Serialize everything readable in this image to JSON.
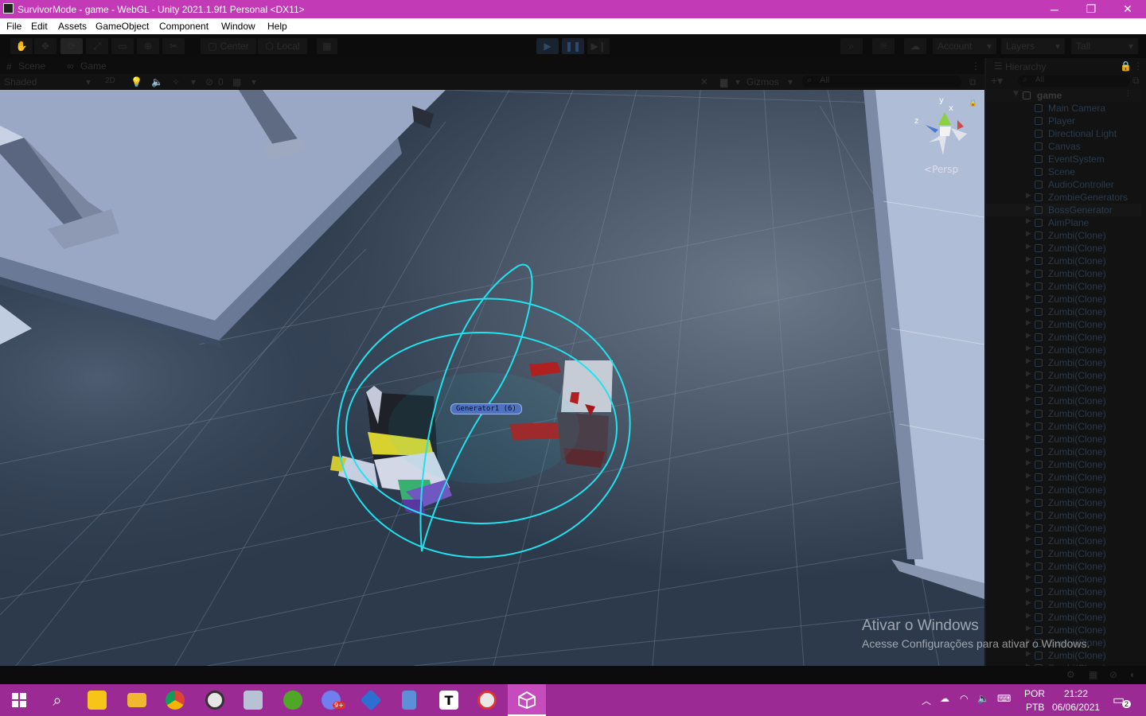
{
  "window": {
    "title": "SurvivorMode - game - WebGL - Unity 2021.1.9f1 Personal <DX11>",
    "minimize": "─",
    "maximize": "❐",
    "close": "✕"
  },
  "menu": [
    "File",
    "Edit",
    "Assets",
    "GameObject",
    "Component",
    "Window",
    "Help"
  ],
  "toolbar": {
    "center": "Center",
    "local": "Local",
    "account": "Account",
    "layers": "Layers",
    "layout": "Tall"
  },
  "scene_tabs": {
    "scene": "Scene",
    "game": "Game"
  },
  "scene_tools": {
    "shading": "Shaded",
    "mode_2d": "2D",
    "hidden_count": "0",
    "gizmos": "Gizmos",
    "search_placeholder": "All"
  },
  "viewport": {
    "object_label": "Generator1 (6)",
    "gizmo_y": "y",
    "gizmo_x": "x",
    "gizmo_z": "z",
    "projection": "Persp"
  },
  "hierarchy": {
    "title": "Hierarchy",
    "search_placeholder": "All",
    "root": "game",
    "items": [
      "Main Camera",
      "Player",
      "Directional Light",
      "Canvas",
      "EventSystem",
      "Scene",
      "AudioController",
      "ZombieGenerators",
      "BossGenerator",
      "AimPlane",
      "Zumbi(Clone)",
      "Zumbi(Clone)",
      "Zumbi(Clone)",
      "Zumbi(Clone)",
      "Zumbi(Clone)",
      "Zumbi(Clone)",
      "Zumbi(Clone)",
      "Zumbi(Clone)",
      "Zumbi(Clone)",
      "Zumbi(Clone)",
      "Zumbi(Clone)",
      "Zumbi(Clone)",
      "Zumbi(Clone)",
      "Zumbi(Clone)",
      "Zumbi(Clone)",
      "Zumbi(Clone)",
      "Zumbi(Clone)",
      "Zumbi(Clone)",
      "Zumbi(Clone)",
      "Zumbi(Clone)",
      "Zumbi(Clone)",
      "Zumbi(Clone)",
      "Zumbi(Clone)",
      "Zumbi(Clone)",
      "Zumbi(Clone)",
      "Zumbi(Clone)",
      "Zumbi(Clone)",
      "Zumbi(Clone)",
      "Zumbi(Clone)",
      "Zumbi(Clone)",
      "Zumbi(Clone)",
      "Zumbi(Clone)",
      "Zumbi(Clone)",
      "Zumbi(Clone)",
      "Zumbi(Clone)"
    ]
  },
  "watermark": {
    "line1": "Ativar o Windows",
    "line2": "Acesse Configurações para ativar o Windows."
  },
  "taskbar": {
    "apps": [
      "start-icon",
      "search-icon",
      "sticky-notes-icon",
      "file-explorer-icon",
      "chrome-icon",
      "obs-icon",
      "photos-icon",
      "utorrent-icon",
      "discord-icon",
      "sourcetree-icon",
      "calculator-icon",
      "typora-icon",
      "paint-icon",
      "unity-icon"
    ],
    "discord_badge": "9+",
    "language": "POR",
    "keyboard": "PTB",
    "time": "21:22",
    "date": "06/06/2021",
    "notifications": "2"
  }
}
